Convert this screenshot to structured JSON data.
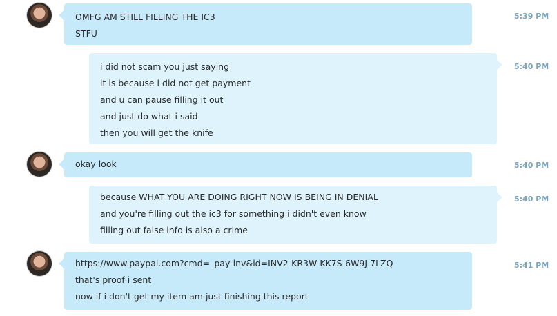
{
  "messages": [
    {
      "sender": "contact",
      "time": "5:39 PM",
      "lines": [
        "OMFG AM STILL FILLING THE IC3",
        "STFU"
      ]
    },
    {
      "sender": "self",
      "time": "5:40 PM",
      "lines": [
        "i did not scam you just saying",
        "it is because i did not get payment",
        "and u can pause filling it out",
        "and just do what i said",
        "then you will get the knife"
      ]
    },
    {
      "sender": "contact",
      "time": "5:40 PM",
      "lines": [
        "okay look"
      ]
    },
    {
      "sender": "self",
      "time": "5:40 PM",
      "lines": [
        "because WHAT YOU ARE DOING RIGHT NOW IS BEING IN DENIAL",
        "and you're filling out the ic3 for something i didn't even know",
        "filling out false info is also a crime"
      ]
    },
    {
      "sender": "contact",
      "time": "5:41 PM",
      "lines": [
        "https://www.paypal.com?cmd=_pay-inv&id=INV2-KR3W-KK7S-6W9J-7LZQ",
        "that's proof i sent",
        "now if i don't get my item am just finishing this report"
      ]
    }
  ]
}
